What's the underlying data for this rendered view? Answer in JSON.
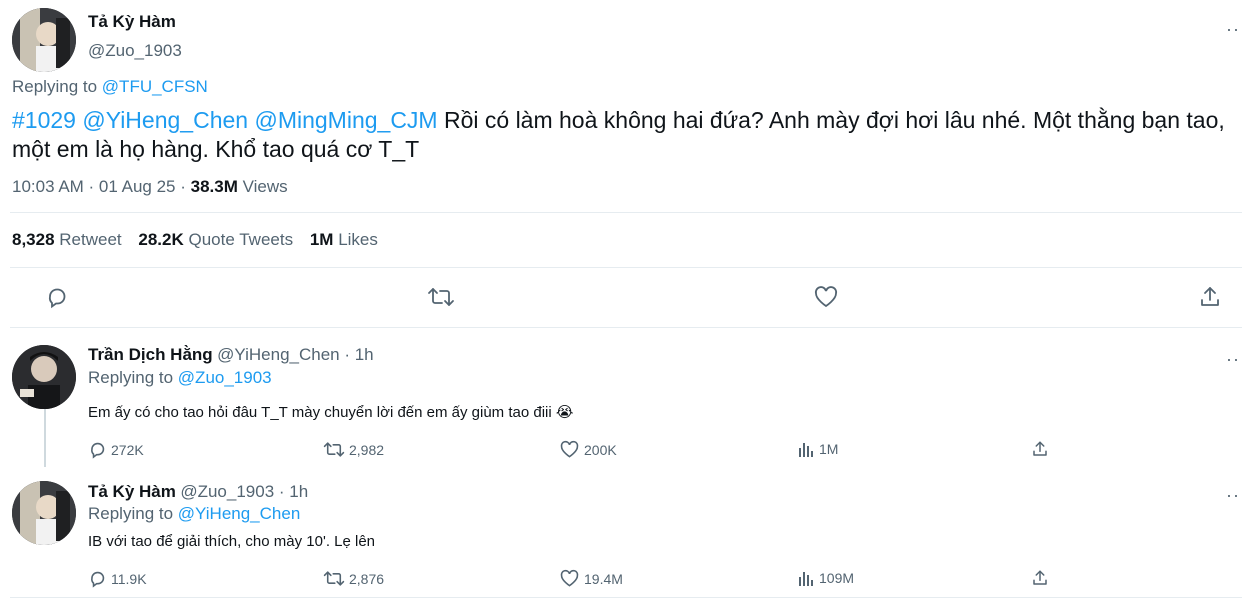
{
  "main_tweet": {
    "author_name": "Tả Kỳ Hàm",
    "author_handle": "@Zuo_1903",
    "replying_label": "Replying to",
    "replying_to": "@TFU_CFSN",
    "text_hashtag": "#1029",
    "text_mention_1": "@YiHeng_Chen",
    "text_mention_2": "@MingMing_CJM",
    "text_line1_rest": " Rồi có làm hoà không hai đứa? Anh mày đợi hơi lâu nhé. Một thằng bạn tao,",
    "text_line2": "một em là họ hàng. Khổ tao quá cơ T_T",
    "time": "10:03 AM · 01 Aug 25 · ",
    "views_count": "38.3M",
    "views_label": " Views",
    "retweets_count": "8,328",
    "retweets_label": "Retweet",
    "quotes_count": "28.2K",
    "quotes_label": "Quote Tweets",
    "likes_count": "1M",
    "likes_label": "Likes",
    "more": "··"
  },
  "replies": [
    {
      "author_name": "Trần Dịch Hằng",
      "author_handle": "@YiHeng_Chen · 1h",
      "replying_label": "Replying to",
      "replying_to": "@Zuo_1903",
      "text": "Em ấy có cho tao hỏi đâu T_T mày chuyển lời đến em ấy giùm tao điii 😭",
      "replies": "272K",
      "retweets": "2,982",
      "likes": "200K",
      "views": "1M",
      "more": "··"
    },
    {
      "author_name": "Tả Kỳ Hàm",
      "author_handle": "@Zuo_1903 · 1h",
      "replying_label": "Replying to",
      "replying_to": "@YiHeng_Chen",
      "text": "IB với tao để giải thích, cho mày 10'. Lẹ lên",
      "replies": "11.9K",
      "retweets": "2,876",
      "likes": "19.4M",
      "views": "109M",
      "more": "··"
    }
  ],
  "colors": {
    "link": "#1d9bf0",
    "muted": "#536471",
    "text": "#0f1419",
    "divider": "#e6ecf0"
  }
}
